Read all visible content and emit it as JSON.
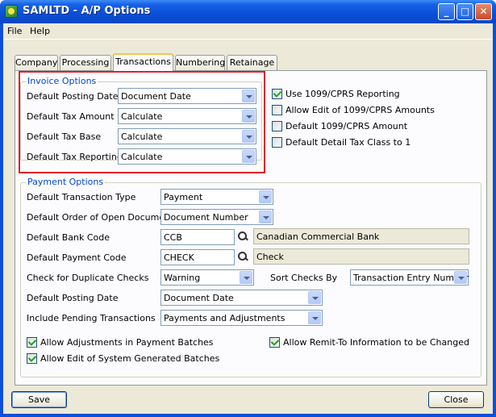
{
  "window": {
    "title": "SAMLTD - A/P Options"
  },
  "menu": {
    "file": "File",
    "help": "Help"
  },
  "tabs": [
    {
      "label": "Company"
    },
    {
      "label": "Processing"
    },
    {
      "label": "Transactions"
    },
    {
      "label": "Numbering"
    },
    {
      "label": "Retainage"
    }
  ],
  "invoice": {
    "title": "Invoice Options",
    "posting_date_label": "Default Posting Date",
    "posting_date_value": "Document Date",
    "tax_amount_label": "Default Tax Amount",
    "tax_amount_value": "Calculate",
    "tax_base_label": "Default Tax Base",
    "tax_base_value": "Calculate",
    "tax_reporting_label": "Default Tax Reporting",
    "tax_reporting_value": "Calculate"
  },
  "checkboxes_right": [
    {
      "label": "Use 1099/CPRS Reporting",
      "checked": true
    },
    {
      "label": "Allow Edit of 1099/CPRS Amounts",
      "checked": false
    },
    {
      "label": "Default 1099/CPRS Amount",
      "checked": false
    },
    {
      "label": "Default Detail Tax Class to 1",
      "checked": false
    }
  ],
  "payment": {
    "title": "Payment Options",
    "trans_type_label": "Default Transaction Type",
    "trans_type_value": "Payment",
    "order_label": "Default Order of Open Documents",
    "order_value": "Document Number",
    "bank_code_label": "Default Bank Code",
    "bank_code_value": "CCB",
    "bank_code_desc": "Canadian Commercial Bank",
    "payment_code_label": "Default Payment Code",
    "payment_code_value": "CHECK",
    "payment_code_desc": "Check",
    "dup_checks_label": "Check for Duplicate Checks",
    "dup_checks_value": "Warning",
    "sort_checks_label": "Sort Checks By",
    "sort_checks_value": "Transaction Entry Number",
    "posting_date_label": "Default Posting Date",
    "posting_date_value": "Document Date",
    "pending_label": "Include Pending Transactions",
    "pending_value": "Payments and Adjustments",
    "allow_adjustments_label": "Allow Adjustments in Payment Batches",
    "allow_adjustments_checked": true,
    "allow_edit_system_label": "Allow Edit of System Generated Batches",
    "allow_edit_system_checked": true,
    "allow_remit_label": "Allow Remit-To Information to be Changed",
    "allow_remit_checked": true
  },
  "buttons": {
    "save": "Save",
    "close": "Close"
  }
}
